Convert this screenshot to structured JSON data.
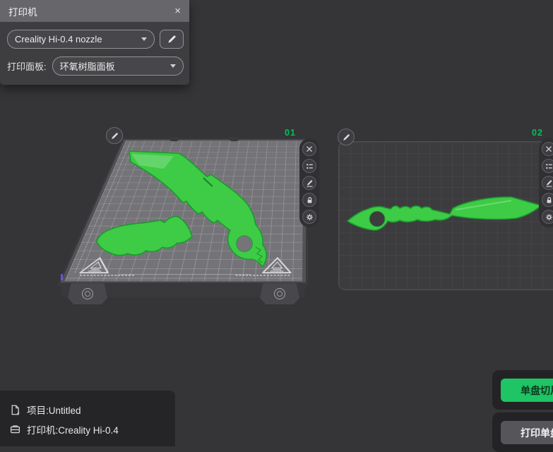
{
  "printer_panel": {
    "title": "打印机",
    "close": "×",
    "printer_dropdown": {
      "value": "Creality Hi-0.4 nozzle"
    },
    "plate_row": {
      "label": "打印面板:",
      "value": "环氧树脂面板"
    }
  },
  "plates": {
    "plate1": {
      "badge": "01"
    },
    "plate2": {
      "badge": "02"
    }
  },
  "footer": {
    "project": "项目:Untitled",
    "printer": "打印机:Creality Hi-0.4"
  },
  "actions": {
    "slice_plate": "单盘切片",
    "print_plate": "打印单盘"
  },
  "icons": {
    "panel": [
      "close-icon",
      "chevron-down-icon",
      "pencil-icon"
    ],
    "plate_toolbar": [
      "delete-plate-icon",
      "object-list-icon",
      "rename-plate-icon",
      "lock-plate-icon",
      "plate-settings-icon"
    ],
    "footer": [
      "project-file-icon",
      "printer-icon"
    ]
  },
  "colors": {
    "background": "#353538",
    "panel_header": "#67676b",
    "panel_body": "#3e3e41",
    "badge_green": "#00c159",
    "button_green": "#1fc464",
    "model_green": "#3ecb45",
    "plate1_surface": "#747478",
    "plate2_surface": "#3c3c3f"
  }
}
